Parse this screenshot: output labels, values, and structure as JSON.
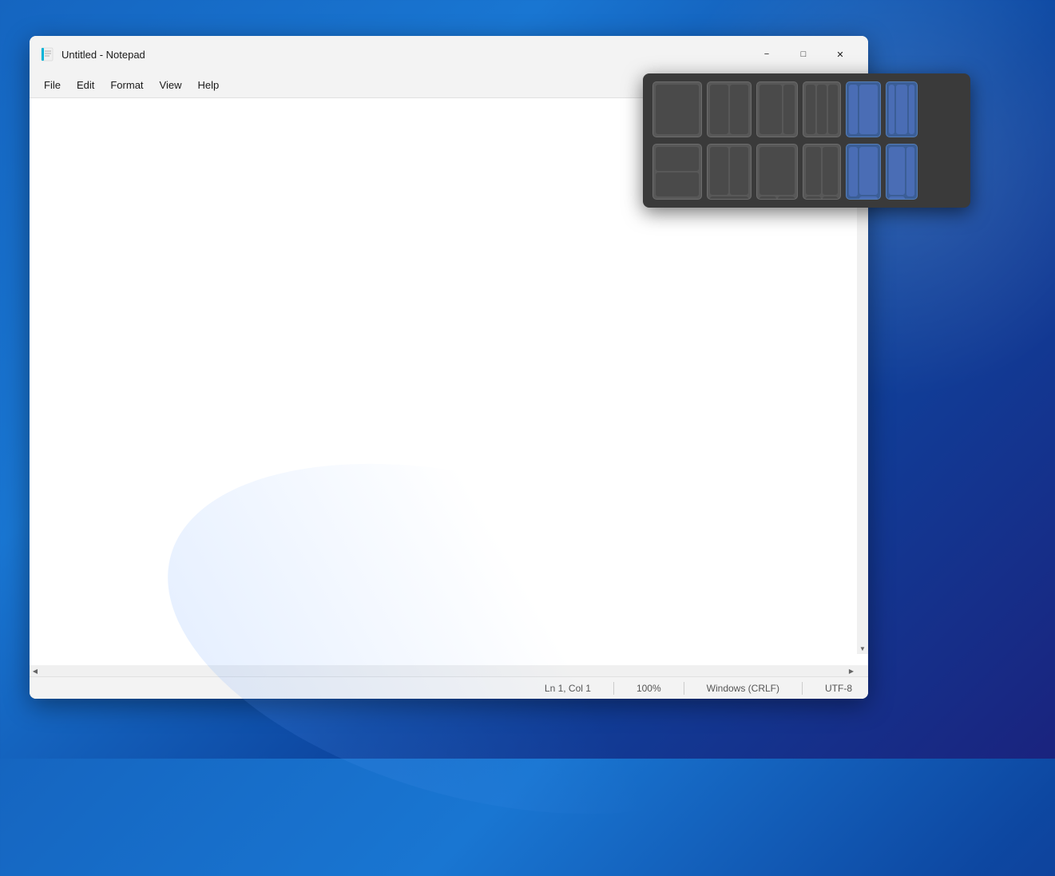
{
  "window": {
    "title": "Untitled - Notepad",
    "icon_char": "📄"
  },
  "title_bar": {
    "text": "Untitled - Notepad",
    "minimize_label": "−",
    "maximize_label": "□",
    "close_label": "✕"
  },
  "menu": {
    "items": [
      "File",
      "Edit",
      "Format",
      "View",
      "Help"
    ]
  },
  "editor": {
    "placeholder": "",
    "content": ""
  },
  "status_bar": {
    "position": "Ln 1, Col 1",
    "zoom": "100%",
    "line_ending": "Windows (CRLF)",
    "encoding": "UTF-8"
  },
  "snap_layouts": {
    "row1": [
      {
        "id": "layout-1",
        "type": "single",
        "highlighted": false
      },
      {
        "id": "layout-2",
        "type": "half-half",
        "highlighted": false
      },
      {
        "id": "layout-3",
        "type": "two-third-third",
        "highlighted": false
      },
      {
        "id": "layout-4",
        "type": "three-col",
        "highlighted": false
      },
      {
        "id": "layout-5",
        "type": "narrow-wide-narrow",
        "highlighted": true
      },
      {
        "id": "layout-6",
        "type": "wide-narrow",
        "highlighted": true
      }
    ],
    "row2": [
      {
        "id": "layout-7",
        "type": "top-bottom",
        "highlighted": false
      },
      {
        "id": "layout-8",
        "type": "top-split-bottom",
        "highlighted": false
      },
      {
        "id": "layout-9",
        "type": "split-top-bottom",
        "highlighted": false
      },
      {
        "id": "layout-10",
        "type": "quarter-grid",
        "highlighted": false
      },
      {
        "id": "layout-11",
        "type": "narrow-stack-wide",
        "highlighted": true
      },
      {
        "id": "layout-12",
        "type": "wide-narrow-stack",
        "highlighted": true
      }
    ]
  },
  "colors": {
    "background_start": "#1565c0",
    "background_end": "#1a237e",
    "window_bg": "#f3f3f3",
    "snap_bg": "#3a3a3a",
    "snap_cell": "#585858",
    "snap_cell_blue": "#3d6199",
    "snap_cell_blue_light": "#4a72aa"
  }
}
